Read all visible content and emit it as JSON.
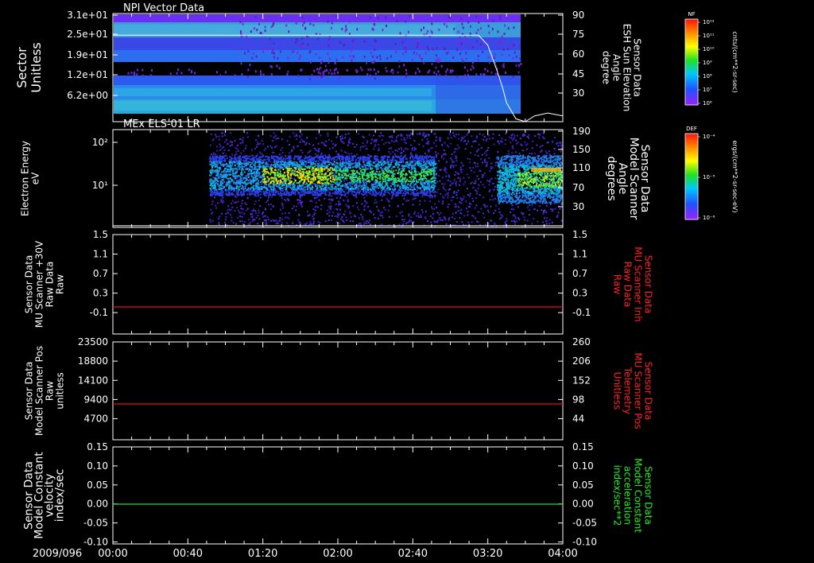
{
  "date_label": "2009/096",
  "time_axis": {
    "range_min": [
      0,
      240
    ],
    "ticks": [
      {
        "min": 0,
        "label": "00:00"
      },
      {
        "min": 40,
        "label": "00:40"
      },
      {
        "min": 80,
        "label": "01:20"
      },
      {
        "min": 120,
        "label": "02:00"
      },
      {
        "min": 160,
        "label": "02:40"
      },
      {
        "min": 200,
        "label": "03:20"
      },
      {
        "min": 240,
        "label": "04:00"
      }
    ]
  },
  "colorbars": [
    {
      "tag": "NF",
      "unit": "cnts/(cm**2-sr-sec)",
      "ticks": [
        "10¹²",
        "10¹¹",
        "10¹⁰",
        "10⁹",
        "10⁸",
        "10⁷",
        "10⁶"
      ]
    },
    {
      "tag": "DEF",
      "unit": "ergs/(cm**2-sr-sec-eV)",
      "ticks": [
        "10⁻⁴",
        "10⁻⁵",
        "10⁻⁶"
      ]
    }
  ],
  "chart_data": [
    {
      "type": "heatmap",
      "title": "NPI Vector Data",
      "ylabel": [
        "Sector",
        "Unitless"
      ],
      "yticks": [
        "3.1e+01",
        "2.5e+01",
        "1.9e+01",
        "1.2e+01",
        "6.2e+00"
      ],
      "ylabel_right": [
        "Sensor Data",
        "ESH Sun Elevation",
        "Angle",
        "degree"
      ],
      "yticks_right": [
        "90",
        "75",
        "60",
        "45",
        "30"
      ],
      "ylim_right": [
        15,
        90
      ],
      "overlay_line": {
        "x": [
          0,
          195,
          200,
          205,
          208,
          210,
          215,
          220,
          225,
          232,
          240
        ],
        "y": [
          75,
          75,
          68,
          50,
          38,
          28,
          17,
          15,
          19,
          21,
          19
        ]
      }
    },
    {
      "type": "heatmap",
      "title": "MEx ELS-01 LR",
      "ylabel": [
        "Electron Energy",
        "eV"
      ],
      "yticks": [
        "10²",
        "10¹"
      ],
      "ylabel_right": [
        "Sensor Data",
        "Model Scanner",
        "Angle",
        "degrees"
      ],
      "yticks_right": [
        "190",
        "150",
        "110",
        "70",
        "30"
      ],
      "ylim_right": [
        10,
        190
      ],
      "overlay_line": {
        "x": [
          0,
          240
        ],
        "y": [
          13,
          13
        ]
      }
    },
    {
      "type": "line",
      "ylabel": [
        "Sensor Data",
        "MU Scanner +30V",
        "Raw Data",
        "Raw"
      ],
      "yticks": [
        "1.5",
        "1.1",
        "0.7",
        "0.3",
        "-0.1"
      ],
      "ylim": [
        -0.5,
        1.5
      ],
      "ylabel_right": [
        "Sensor Data",
        "MU Scanner Inh",
        "Raw Data",
        "Raw"
      ],
      "yticks_right": [
        "1.5",
        "1.1",
        "0.7",
        "0.3",
        "-0.1"
      ],
      "series": [
        {
          "color": "#e01010",
          "x": [
            0,
            240
          ],
          "y": [
            0,
            0
          ]
        }
      ]
    },
    {
      "type": "line",
      "ylabel": [
        "Sensor Data",
        "Model Scanner Pos",
        "Raw",
        "unitless"
      ],
      "yticks": [
        "23500",
        "18800",
        "14100",
        "9400",
        "4700"
      ],
      "ylim": [
        0,
        23500
      ],
      "ylabel_right": [
        "Sensor Data",
        "MU Scanner Pos",
        "Telemetry",
        "Unitless"
      ],
      "yticks_right": [
        "260",
        "206",
        "152",
        "98",
        "44"
      ],
      "series": [
        {
          "color": "#e01010",
          "x": [
            0,
            240
          ],
          "y": [
            8400,
            8400
          ]
        }
      ]
    },
    {
      "type": "line",
      "ylabel": [
        "Sensor Data",
        "Model Constant",
        "velocity",
        "index/sec"
      ],
      "yticks": [
        "0.15",
        "0.10",
        "0.05",
        "0.00",
        "-0.05",
        "-0.10"
      ],
      "ylim": [
        -0.1,
        0.15
      ],
      "ylabel_right": [
        "Sensor Data",
        "Model Constant",
        "acceleration",
        "index/sec**2"
      ],
      "yticks_right": [
        "0.15",
        "0.10",
        "0.05",
        "0.00",
        "-0.05",
        "-0.10"
      ],
      "series": [
        {
          "color": "#22dd22",
          "x": [
            0,
            240
          ],
          "y": [
            0,
            0
          ]
        }
      ]
    }
  ],
  "colors": {
    "axis": "#ffffff",
    "red_label": "#ff2020",
    "green_label": "#22ee22"
  }
}
